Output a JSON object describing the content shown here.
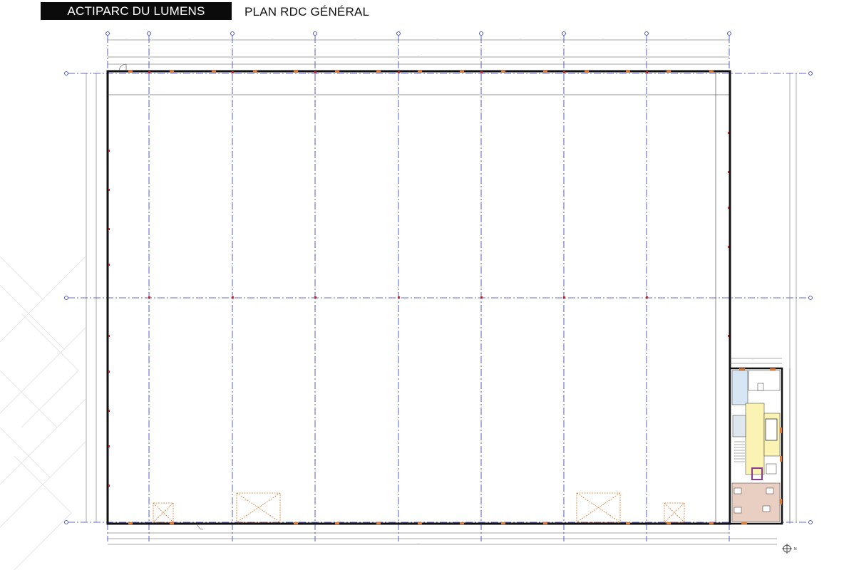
{
  "header": {
    "project_name": "ACTIPARC DU LUMENS",
    "plan_title": "PLAN RDC GÉNÉRAL"
  },
  "plan": {
    "north_label": "N",
    "colors": {
      "wall": "#111111",
      "grid_axis": "#2b36c4",
      "column_mark": "#cc2222",
      "opening": "#e07a2a",
      "office_yellow": "#fbf3b4",
      "office_blue": "#d6e6f4",
      "office_pink": "#e9cfc2",
      "office_purple": "#8a3a8f"
    }
  }
}
